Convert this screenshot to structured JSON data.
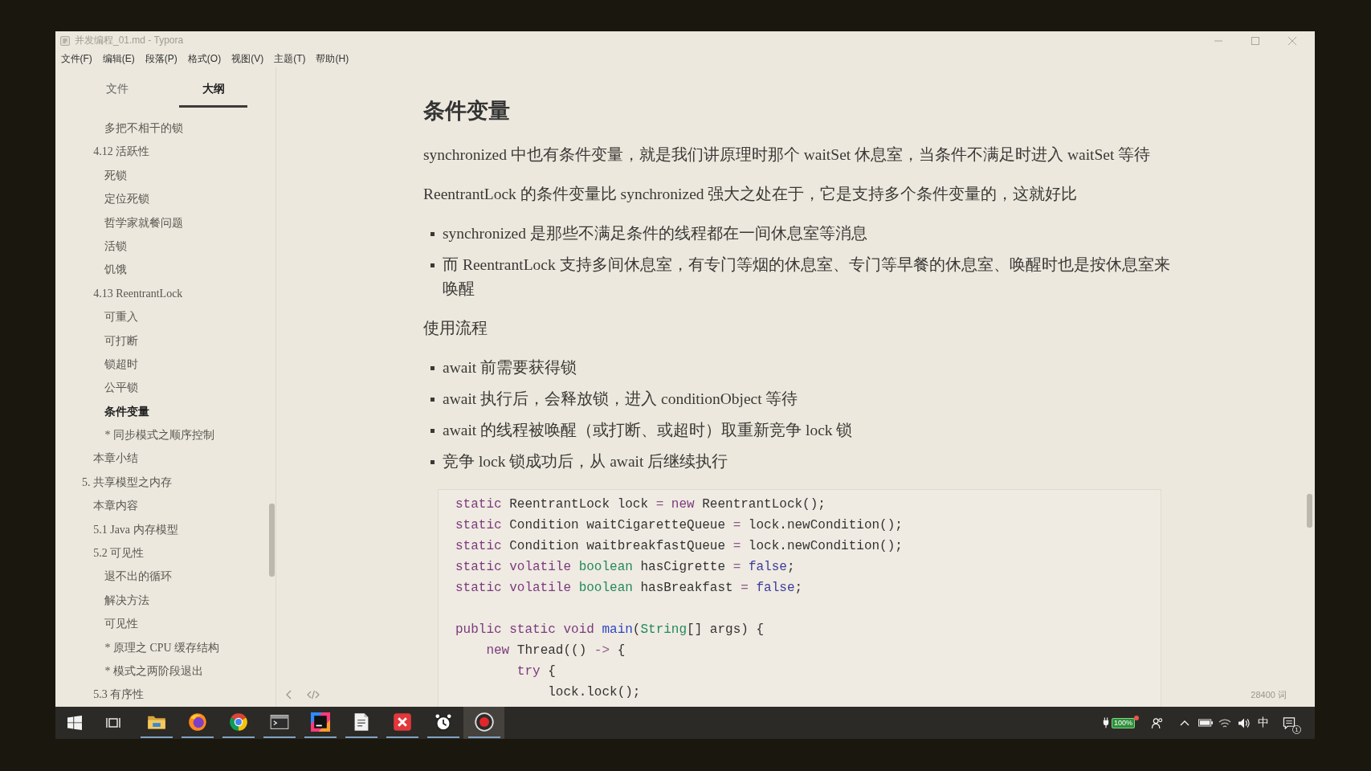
{
  "window": {
    "title": "并发编程_01.md - Typora"
  },
  "menu_bar": [
    "文件(F)",
    "编辑(E)",
    "段落(P)",
    "格式(O)",
    "视图(V)",
    "主题(T)",
    "帮助(H)"
  ],
  "sidebar": {
    "tabs": [
      {
        "label": "文件",
        "selected": false
      },
      {
        "label": "大纲",
        "selected": true
      }
    ],
    "outline": [
      {
        "children": [
          {
            "children": [
              {
                "label": "多把不相干的锁",
                "selected": false
              }
            ]
          },
          {
            "label": "4.12 活跃性",
            "selected": false,
            "children": [
              {
                "label": "死锁",
                "selected": false
              },
              {
                "label": "定位死锁",
                "selected": false
              },
              {
                "label": "哲学家就餐问题",
                "selected": false
              },
              {
                "label": "活锁",
                "selected": false
              },
              {
                "label": "饥饿",
                "selected": false
              }
            ]
          },
          {
            "label": "4.13 ReentrantLock",
            "selected": false,
            "children": [
              {
                "label": "可重入",
                "selected": false
              },
              {
                "label": "可打断",
                "selected": false
              },
              {
                "label": "锁超时",
                "selected": false
              },
              {
                "label": "公平锁",
                "selected": false
              },
              {
                "label": "条件变量",
                "selected": true
              },
              {
                "label": "* 同步模式之顺序控制",
                "selected": false
              }
            ]
          },
          {
            "label": "本章小结",
            "selected": false
          }
        ]
      },
      {
        "label": "5. 共享模型之内存",
        "selected": false,
        "children": [
          {
            "label": "本章内容",
            "selected": false
          },
          {
            "label": "5.1 Java 内存模型",
            "selected": false
          },
          {
            "label": "5.2 可见性",
            "selected": false,
            "children": [
              {
                "label": "退不出的循环",
                "selected": false
              },
              {
                "label": "解决方法",
                "selected": false
              },
              {
                "label": "可见性",
                "selected": false
              },
              {
                "label": "* 原理之 CPU 缓存结构",
                "selected": false
              },
              {
                "label": "* 模式之两阶段退出",
                "selected": false
              }
            ]
          },
          {
            "label": "5.3 有序性",
            "selected": false
          }
        ]
      }
    ]
  },
  "document": {
    "blocks": [
      {
        "kind": "heading",
        "text": "条件变量"
      },
      {
        "kind": "paragraph",
        "text": "synchronized 中也有条件变量，就是我们讲原理时那个 waitSet 休息室，当条件不满足时进入 waitSet 等待"
      },
      {
        "kind": "paragraph",
        "text": "ReentrantLock 的条件变量比 synchronized 强大之处在于，它是支持多个条件变量的，这就好比"
      },
      {
        "kind": "list",
        "items": [
          "synchronized 是那些不满足条件的线程都在一间休息室等消息",
          "而 ReentrantLock 支持多间休息室，有专门等烟的休息室、专门等早餐的休息室、唤醒时也是按休息室来唤醒"
        ]
      },
      {
        "kind": "paragraph",
        "text": "使用流程"
      },
      {
        "kind": "list",
        "items": [
          "await 前需要获得锁",
          "await 执行后，会释放锁，进入 conditionObject 等待",
          "await 的线程被唤醒（或打断、或超时）取重新竞争 lock 锁",
          "竞争 lock 锁成功后，从 await 后继续执行"
        ]
      },
      {
        "kind": "code",
        "sections": [
          {
            "lines": [
              {
                "tokens": [
                  {
                    "kind": "keyword",
                    "text": "static"
                  },
                  {
                    "kind": "plain",
                    "text": " ReentrantLock lock "
                  },
                  {
                    "kind": "operator",
                    "text": "= "
                  },
                  {
                    "kind": "keyword",
                    "text": "new"
                  },
                  {
                    "kind": "plain",
                    "text": " ReentrantLock();"
                  }
                ]
              },
              {
                "tokens": [
                  {
                    "kind": "keyword",
                    "text": "static"
                  },
                  {
                    "kind": "plain",
                    "text": " Condition waitCigaretteQueue "
                  },
                  {
                    "kind": "operator",
                    "text": "="
                  },
                  {
                    "kind": "plain",
                    "text": " lock.newCondition();"
                  }
                ]
              },
              {
                "tokens": [
                  {
                    "kind": "keyword",
                    "text": "static"
                  },
                  {
                    "kind": "plain",
                    "text": " Condition waitbreakfastQueue "
                  },
                  {
                    "kind": "operator",
                    "text": "="
                  },
                  {
                    "kind": "plain",
                    "text": " lock.newCondition();"
                  }
                ]
              },
              {
                "tokens": [
                  {
                    "kind": "keyword",
                    "text": "static volatile "
                  },
                  {
                    "kind": "type",
                    "text": "boolean"
                  },
                  {
                    "kind": "plain",
                    "text": " hasCigrette "
                  },
                  {
                    "kind": "operator",
                    "text": "= "
                  },
                  {
                    "kind": "atom",
                    "text": "false"
                  },
                  {
                    "kind": "plain",
                    "text": ";"
                  }
                ]
              },
              {
                "tokens": [
                  {
                    "kind": "keyword",
                    "text": "static volatile "
                  },
                  {
                    "kind": "type",
                    "text": "boolean"
                  },
                  {
                    "kind": "plain",
                    "text": " hasBreakfast "
                  },
                  {
                    "kind": "operator",
                    "text": "= "
                  },
                  {
                    "kind": "atom",
                    "text": "false"
                  },
                  {
                    "kind": "plain",
                    "text": ";"
                  }
                ]
              }
            ]
          },
          {
            "lines": [
              {
                "tokens": [
                  {
                    "kind": "keyword",
                    "text": "public static void "
                  },
                  {
                    "kind": "def",
                    "text": "main"
                  },
                  {
                    "kind": "plain",
                    "text": "("
                  },
                  {
                    "kind": "type",
                    "text": "String"
                  },
                  {
                    "kind": "plain",
                    "text": "[] args) {"
                  }
                ]
              },
              {
                "tokens": [
                  {
                    "kind": "keyword",
                    "text": "    new"
                  },
                  {
                    "kind": "plain",
                    "text": " Thread(() "
                  },
                  {
                    "kind": "operator",
                    "text": "->"
                  },
                  {
                    "kind": "plain",
                    "text": " {"
                  }
                ]
              },
              {
                "tokens": [
                  {
                    "kind": "keyword",
                    "text": "        try"
                  },
                  {
                    "kind": "plain",
                    "text": " {"
                  }
                ]
              },
              {
                "tokens": [
                  {
                    "kind": "plain",
                    "text": "            lock.lock();"
                  }
                ]
              }
            ]
          }
        ]
      }
    ]
  },
  "status_bar": {
    "word_count": "28400 词"
  },
  "taskbar": {
    "apps": [
      {
        "kind": "folder",
        "running": true,
        "selected": false
      },
      {
        "kind": "flame",
        "running": true,
        "selected": false
      },
      {
        "kind": "wheel",
        "running": true,
        "selected": false
      },
      {
        "kind": "terminal",
        "running": true,
        "selected": false
      },
      {
        "kind": "ide",
        "running": true,
        "selected": false
      },
      {
        "kind": "page",
        "running": true,
        "selected": false
      },
      {
        "kind": "cross",
        "running": true,
        "selected": false
      },
      {
        "kind": "clock",
        "running": true,
        "selected": false
      },
      {
        "kind": "record",
        "running": true,
        "selected": true
      }
    ],
    "tray": {
      "battery": "100%",
      "input_method": "中",
      "notification_count": "1"
    }
  }
}
